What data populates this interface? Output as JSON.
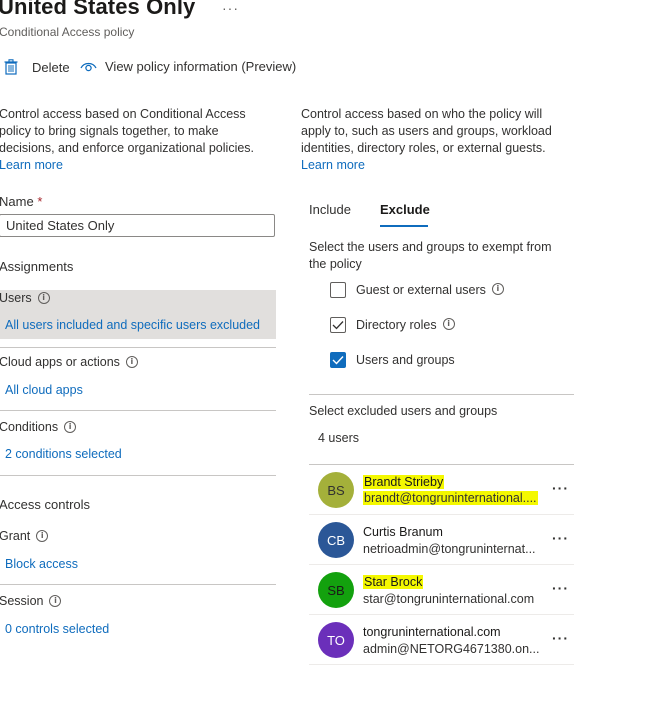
{
  "header": {
    "title": "United States Only",
    "more_label": "···",
    "subtitle": "Conditional Access policy"
  },
  "toolbar": {
    "delete_label": "Delete",
    "view_info_label": "View policy information (Preview)"
  },
  "left": {
    "description": "Control access based on Conditional Access policy to bring signals together, to make decisions, and to enforce organizational policies.",
    "desc_lines": [
      "Control access based on Conditional Access",
      "policy to bring signals together, to make",
      "decisions, and enforce organizational policies."
    ],
    "learn_more": "Learn more",
    "name_label": "Name",
    "name_required": "*",
    "name_value": "United States Only",
    "assignments_heading": "Assignments",
    "users_label": "Users",
    "users_value": "All users included and specific users excluded",
    "cloud_apps_label": "Cloud apps or actions",
    "cloud_apps_value": "All cloud apps",
    "conditions_label": "Conditions",
    "conditions_value": "2 conditions selected",
    "access_controls_heading": "Access controls",
    "grant_label": "Grant",
    "grant_value": "Block access",
    "session_label": "Session",
    "session_value": "0 controls selected"
  },
  "right": {
    "desc_lines": [
      "Control access based on who the policy will",
      "apply to, such as users and groups, workload",
      "identities, directory roles, or external guests."
    ],
    "learn_more": "Learn more",
    "tabs": [
      {
        "label": "Include",
        "active": false
      },
      {
        "label": "Exclude",
        "active": true
      }
    ],
    "exclude_desc_lines": [
      "Select the users and groups to exempt from",
      "the policy"
    ],
    "checkboxes": [
      {
        "label": "Guest or external users",
        "checked": false,
        "info": true
      },
      {
        "label": "Directory roles",
        "checked": true,
        "info": true
      },
      {
        "label": "Users and groups",
        "checked": true,
        "info": false
      }
    ],
    "select_excluded_label": "Select excluded users and groups",
    "users_count": "4 users",
    "users": [
      {
        "initials": "BS",
        "name": "Brandt Strieby",
        "email": "brandt@tongruninternational....",
        "avatar_color": "#a4b03a",
        "highlight": true
      },
      {
        "initials": "CB",
        "name": "Curtis Branum",
        "email": "netrioadmin@tongruninternat...",
        "avatar_color": "#2b5797",
        "highlight": false
      },
      {
        "initials": "SB",
        "name": "Star Brock",
        "email": "star@tongruninternational.com",
        "avatar_color": "#13a10e",
        "highlight": true
      },
      {
        "initials": "TO",
        "name": "tongruninternational.com",
        "email": "admin@NETORG4671380.on...",
        "avatar_color": "#6b2fba",
        "highlight": false
      }
    ],
    "row_more_label": "···"
  }
}
